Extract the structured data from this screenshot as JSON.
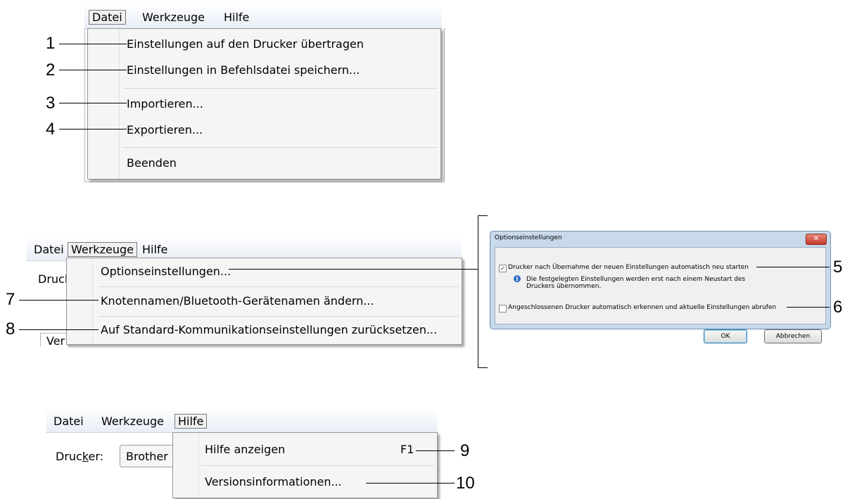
{
  "menubar": {
    "file": "Datei",
    "tools": "Werkzeuge",
    "help": "Hilfe"
  },
  "file_menu": {
    "items": [
      "Einstellungen auf den Drucker übertragen",
      "Einstellungen in Befehlsdatei speichern...",
      "Importieren...",
      "Exportieren...",
      "Beenden"
    ]
  },
  "tools_menu": {
    "background_label": "Druck",
    "background_bottom": "Ver",
    "items": [
      "Optionseinstellungen...",
      "Knotennamen/Bluetooth-Gerätenamen ändern...",
      "Auf Standard-Kommunikationseinstellungen zurücksetzen..."
    ]
  },
  "options_dialog": {
    "title": "Optionseinstellungen",
    "close_glyph": "✕",
    "restart_checkbox": "Drucker nach Übernahme der neuen Einstellungen automatisch neu starten",
    "restart_checked": true,
    "info_icon": "i",
    "info_line1": "Die festgelegten Einstellungen werden erst nach einem Neustart des",
    "info_line2": "Druckers übernommen.",
    "detect_checkbox": "Angeschlossenen Drucker automatisch erkennen und aktuelle Einstellungen abrufen",
    "detect_checked": false,
    "ok": "OK",
    "cancel": "Abbrechen"
  },
  "help_menu": {
    "printer_label_pre": "Druc",
    "printer_label_underline": "k",
    "printer_label_post": "er:",
    "printer_value": "Brother",
    "items": [
      {
        "label": "Hilfe anzeigen",
        "shortcut": "F1"
      },
      {
        "label": "Versionsinformationen...",
        "shortcut": ""
      }
    ]
  },
  "callouts": [
    "1",
    "2",
    "3",
    "4",
    "5",
    "6",
    "7",
    "8",
    "9",
    "10"
  ],
  "icons": [
    "close-icon",
    "checkbox-checked-icon",
    "checkbox-empty-icon",
    "info-icon"
  ]
}
